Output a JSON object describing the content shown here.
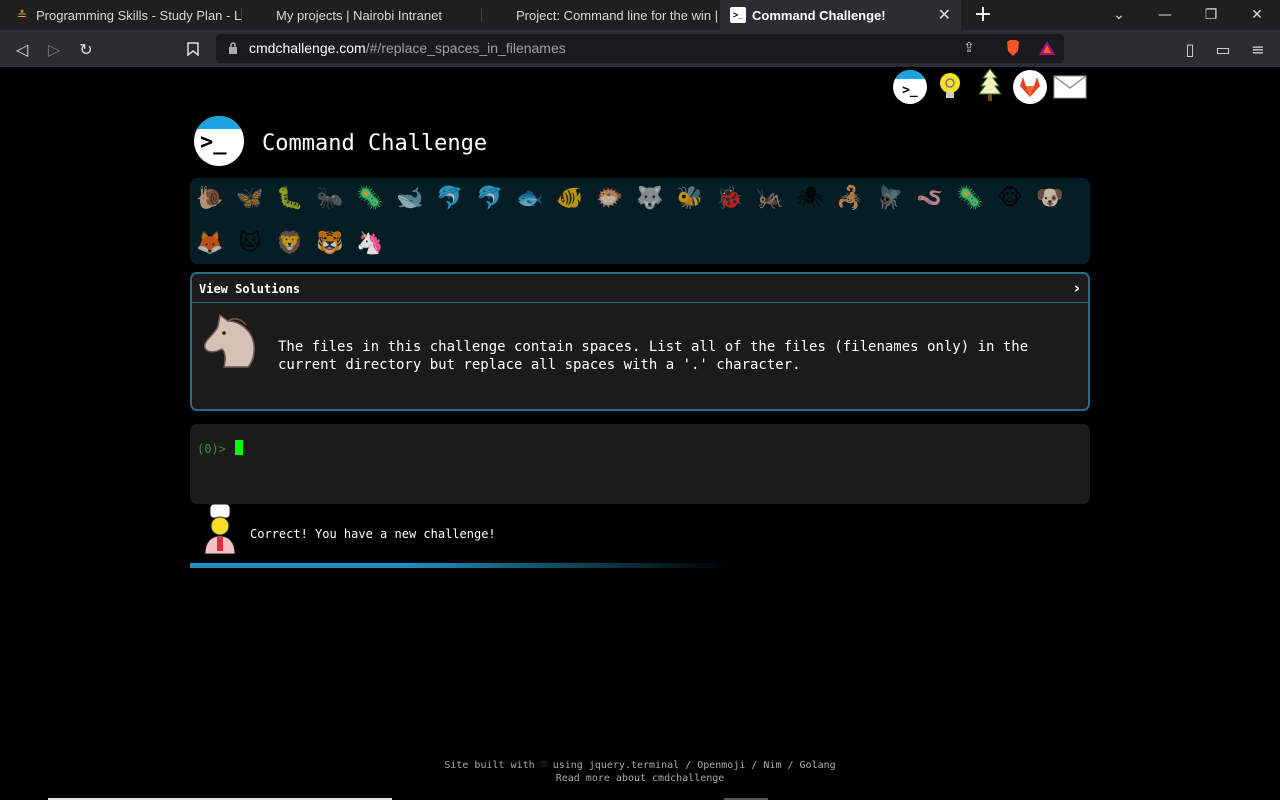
{
  "tabs": [
    {
      "title": "Programming Skills - Study Plan - Leet",
      "icon": "leetcode-icon"
    },
    {
      "title": "My projects | Nairobi Intranet",
      "icon": "intranet-icon"
    },
    {
      "title": "Project: Command line for the win | Na",
      "icon": "intranet-icon"
    },
    {
      "title": "Command Challenge!",
      "icon": "terminal-icon",
      "active": true
    }
  ],
  "address": {
    "host": "cmdchallenge.com",
    "path": "/#/replace_spaces_in_filenames"
  },
  "site": {
    "title": "Command Challenge",
    "logo_text": ">_"
  },
  "top_links": [
    "cmdchallenge-icon",
    "hint-bulb-icon",
    "tree-icon",
    "gitlab-icon",
    "email-icon"
  ],
  "animals_row1": [
    "🐌",
    "🦋",
    "🐛",
    "🐜",
    "🦠",
    "🐋",
    "🐬",
    "🐬",
    "🐟",
    "🐠",
    "🐡",
    "🐺",
    "🐝",
    "🐞",
    "🦗",
    "🕷",
    "🦂",
    "🪰",
    "🪱",
    "🦠",
    "🐵",
    "🐶"
  ],
  "animals_row2": [
    "🦊",
    "🐱",
    "🦁",
    "🐯",
    "🦄"
  ],
  "panel": {
    "toggle_label": "View Solutions",
    "chevron": "›",
    "description_line1": "The files in this challenge contain spaces. List all of the files (filenames only) in the",
    "description_line2": "current directory but replace all spaces with a '.' character."
  },
  "terminal": {
    "prompt": "(0)>"
  },
  "feedback": {
    "message": "Correct! You have a new challenge!"
  },
  "progress": {
    "fraction": 0.42
  },
  "footer": {
    "line1": "Site built with ♡ using jquery.terminal / Openmoji / Nim / Golang",
    "line2": "Read more about cmdchallenge"
  },
  "colors": {
    "accent": "#1aa3e0",
    "panel_border": "#2d6a85",
    "cursor": "#00ff00"
  }
}
